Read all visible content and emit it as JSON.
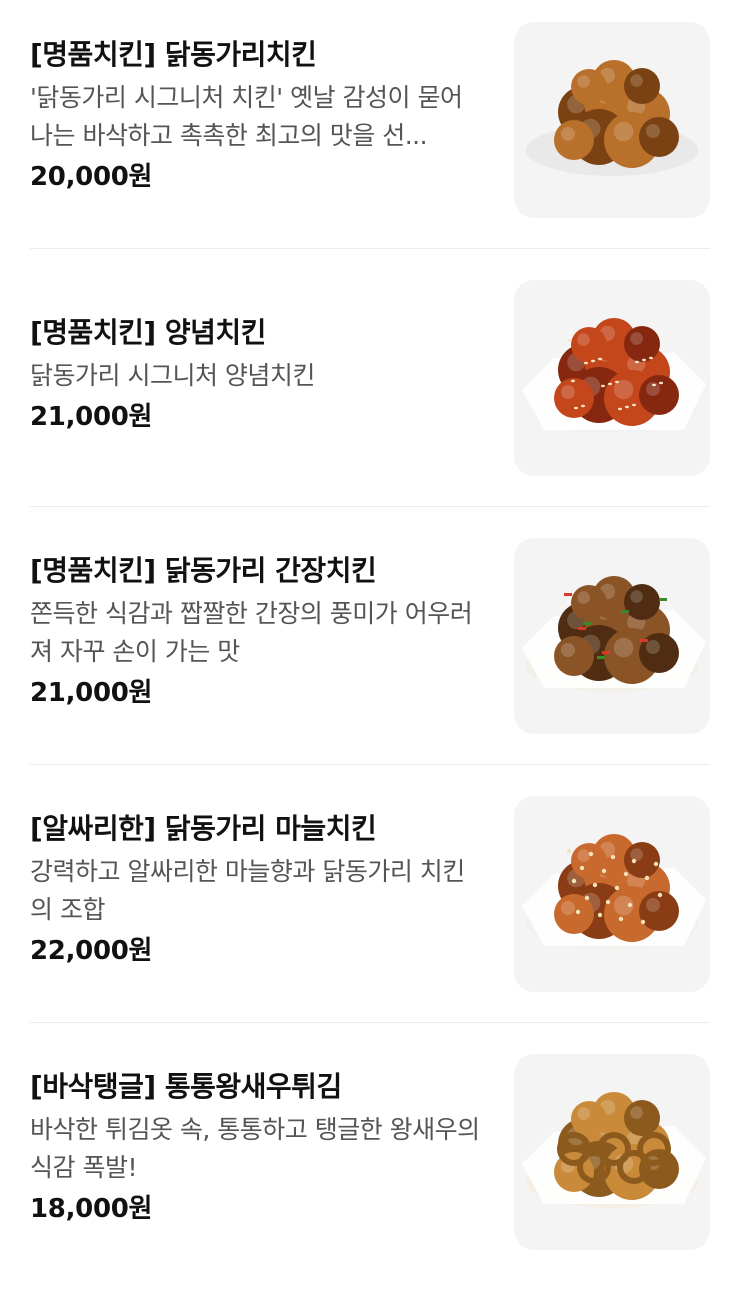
{
  "menu": {
    "items": [
      {
        "title": "[명품치킨] 닭동가리치킨",
        "description": "'닭동가리 시그니처 치킨' 옛날 감성이 묻어나는 바삭하고 촉촉한 최고의 맛을 선...",
        "price": "20,000원",
        "image_icon": "fried-chicken-photo",
        "colors": {
          "main": "#b8702a",
          "dark": "#7a4212",
          "plate": "#e9e9ea"
        }
      },
      {
        "title": "[명품치킨] 양념치킨",
        "description": "닭동가리 시그니처 양념치킨",
        "price": "21,000원",
        "image_icon": "seasoned-chicken-photo",
        "colors": {
          "main": "#c4471b",
          "dark": "#862810",
          "plate": "#f2f2f4"
        }
      },
      {
        "title": "[명품치킨] 닭동가리 간장치킨",
        "description": "쫀득한 식감과 짭짤한 간장의 풍미가 어우러져 자꾸 손이 가는 맛",
        "price": "21,000원",
        "image_icon": "soy-chicken-photo",
        "colors": {
          "main": "#8a5426",
          "dark": "#4f2c12",
          "plate": "#f3f0ea"
        }
      },
      {
        "title": "[알싸리한] 닭동가리 마늘치킨",
        "description": "강력하고 알싸리한 마늘향과 닭동가리 치킨의 조합",
        "price": "22,000원",
        "image_icon": "garlic-chicken-photo",
        "colors": {
          "main": "#c86a2e",
          "dark": "#8a3c14",
          "plate": "#f3f1ee"
        }
      },
      {
        "title": "[바삭탱글] 통통왕새우튀김",
        "description": "바삭한 튀김옷 속, 통통하고 탱글한 왕새우의 식감 폭발!",
        "price": "18,000원",
        "image_icon": "fried-shrimp-photo",
        "colors": {
          "main": "#c98b3a",
          "dark": "#8d5a1e",
          "plate": "#f5efe4"
        }
      }
    ]
  }
}
